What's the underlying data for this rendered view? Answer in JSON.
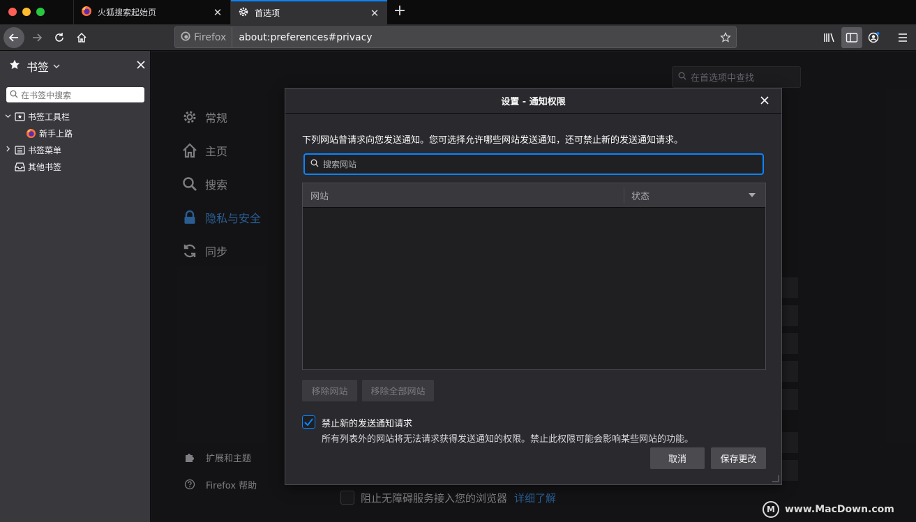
{
  "browser": {
    "tabs": [
      {
        "label": "火狐搜索起始页",
        "icon": "firefox-icon",
        "active": false,
        "close": "✕"
      },
      {
        "label": "首选项",
        "icon": "gear-icon",
        "active": true,
        "close": "✕"
      }
    ],
    "new_tab": "+",
    "url_identity": "Firefox",
    "url": "about:preferences#privacy"
  },
  "sidebar": {
    "title": "书签",
    "search_placeholder": "在书签中搜索",
    "items": [
      {
        "label": "书签工具栏",
        "icon": "bookmarks-toolbar-icon",
        "expanded": true
      },
      {
        "label": "新手上路",
        "icon": "firefox-icon"
      },
      {
        "label": "书签菜单",
        "icon": "bookmarks-menu-icon",
        "expanded": false
      },
      {
        "label": "其他书签",
        "icon": "other-bookmarks-icon"
      }
    ]
  },
  "prefs": {
    "search_placeholder": "在首选项中查找",
    "categories": [
      {
        "label": "常规",
        "icon": "gear-icon",
        "active": false
      },
      {
        "label": "主页",
        "icon": "home-icon",
        "active": false
      },
      {
        "label": "搜索",
        "icon": "search-icon",
        "active": false
      },
      {
        "label": "隐私与安全",
        "icon": "lock-icon",
        "active": true
      },
      {
        "label": "同步",
        "icon": "sync-icon",
        "active": false
      }
    ],
    "footer": [
      {
        "label": "扩展和主题",
        "icon": "puzzle-icon"
      },
      {
        "label": "Firefox 帮助",
        "icon": "help-icon"
      }
    ],
    "accessibility_label": "阻止无障碍服务接入您的浏览器",
    "accessibility_link": "详细了解"
  },
  "dialog": {
    "title": "设置 - 通知权限",
    "description": "下列网站曾请求向您发送通知。您可选择允许哪些网站发送通知，还可禁止新的发送通知请求。",
    "search_placeholder": "搜索网站",
    "table": {
      "columns": [
        "网站",
        "状态"
      ],
      "rows": []
    },
    "remove_site": "移除网站",
    "remove_all": "移除全部网站",
    "block_new_checked": true,
    "block_new_label": "禁止新的发送通知请求",
    "block_new_desc": "所有列表外的网站将无法请求获得发送通知的权限。禁止此权限可能会影响某些网站的功能。",
    "cancel": "取消",
    "save": "保存更改"
  },
  "watermark": "www.MacDown.com",
  "colors": {
    "accent": "#0a84ff",
    "active_category": "#3e8ad8",
    "dialog_bg": "#2a2a2e"
  }
}
